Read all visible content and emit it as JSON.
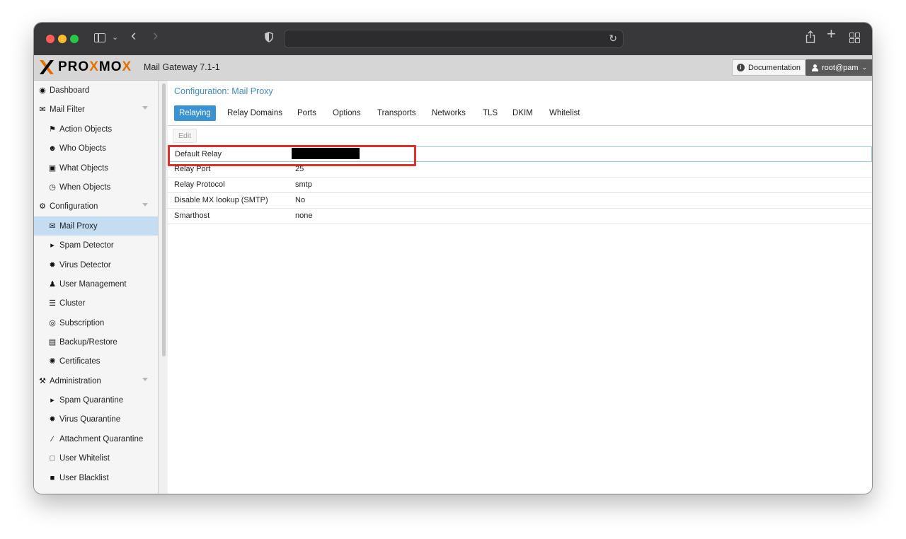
{
  "browser": {
    "address_text": "",
    "icons": [
      "sidebar-toggle-icon",
      "chevron-down-icon",
      "back-icon",
      "forward-icon",
      "shield-icon",
      "reload-icon",
      "share-icon",
      "new-tab-icon",
      "tab-overview-icon"
    ]
  },
  "header": {
    "logo_text": "PROXMOX",
    "product": "Mail Gateway 7.1-1",
    "documentation_label": "Documentation",
    "user_label": "root@pam"
  },
  "sidebar": {
    "items": [
      {
        "label": "Dashboard",
        "icon": "dashboard-icon"
      },
      {
        "label": "Mail Filter",
        "icon": "envelope-icon"
      },
      {
        "label": "Action Objects",
        "icon": "flag-icon"
      },
      {
        "label": "Who Objects",
        "icon": "user-circle-icon"
      },
      {
        "label": "What Objects",
        "icon": "cube-icon"
      },
      {
        "label": "When Objects",
        "icon": "clock-icon"
      },
      {
        "label": "Configuration",
        "icon": "gears-icon"
      },
      {
        "label": "Mail Proxy",
        "icon": "envelope-outline-icon"
      },
      {
        "label": "Spam Detector",
        "icon": "bullhorn-icon"
      },
      {
        "label": "Virus Detector",
        "icon": "bug-icon"
      },
      {
        "label": "User Management",
        "icon": "users-icon"
      },
      {
        "label": "Cluster",
        "icon": "server-icon"
      },
      {
        "label": "Subscription",
        "icon": "life-ring-icon"
      },
      {
        "label": "Backup/Restore",
        "icon": "floppy-icon"
      },
      {
        "label": "Certificates",
        "icon": "certificate-icon"
      },
      {
        "label": "Administration",
        "icon": "wrench-icon"
      },
      {
        "label": "Spam Quarantine",
        "icon": "bullhorn-icon"
      },
      {
        "label": "Virus Quarantine",
        "icon": "bug-icon"
      },
      {
        "label": "Attachment Quarantine",
        "icon": "paperclip-icon"
      },
      {
        "label": "User Whitelist",
        "icon": "file-outline-icon"
      },
      {
        "label": "User Blacklist",
        "icon": "file-icon"
      }
    ]
  },
  "main": {
    "title": "Configuration: Mail Proxy",
    "tabs": [
      "Relaying",
      "Relay Domains",
      "Ports",
      "Options",
      "Transports",
      "Networks",
      "TLS",
      "DKIM",
      "Whitelist"
    ],
    "active_tab": "Relaying",
    "edit_label": "Edit",
    "rows": [
      {
        "key": "Default Relay",
        "value": ""
      },
      {
        "key": "Relay Port",
        "value": "25"
      },
      {
        "key": "Relay Protocol",
        "value": "smtp"
      },
      {
        "key": "Disable MX lookup (SMTP)",
        "value": "No"
      },
      {
        "key": "Smarthost",
        "value": "none"
      }
    ]
  },
  "colors": {
    "accent": "#3892d4",
    "selected_nav": "#c4ddf2",
    "logo_orange": "#e57000",
    "highlight_box": "#e0312a"
  }
}
